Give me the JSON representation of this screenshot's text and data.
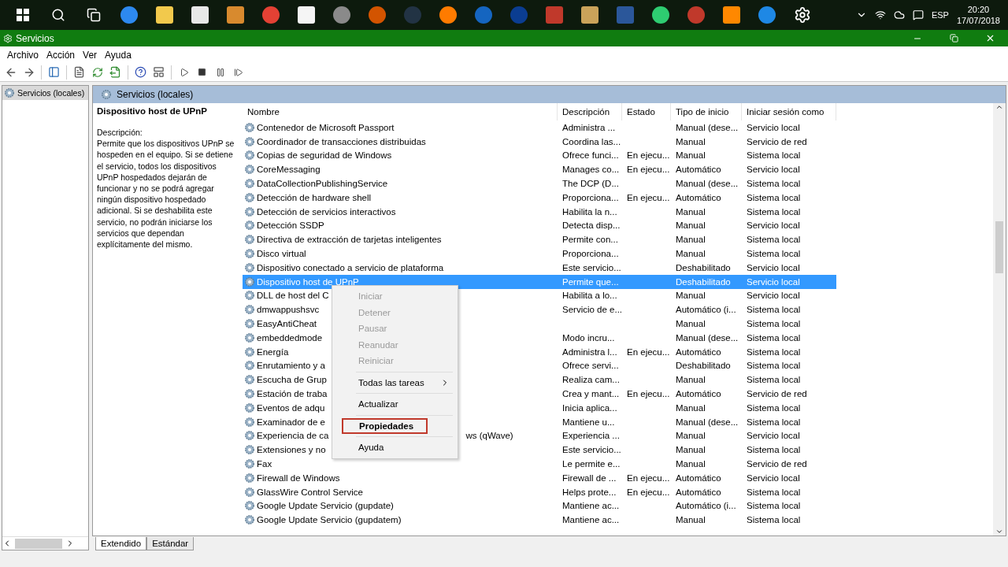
{
  "taskbar": {
    "language": "ESP",
    "time": "20:20",
    "date": "17/07/2018"
  },
  "window": {
    "title": "Servicios"
  },
  "menu": [
    "Archivo",
    "Acción",
    "Ver",
    "Ayuda"
  ],
  "tree": [
    {
      "label": "Servicios (locales)",
      "selected": true
    }
  ],
  "pane_header": "Servicios (locales)",
  "details": {
    "title": "Dispositivo host de UPnP",
    "label": "Descripción:",
    "text": "Permite que los dispositivos UPnP se hospeden en el equipo. Si se detiene el servicio, todos los dispositivos UPnP hospedados dejarán de funcionar y no se podrá agregar ningún dispositivo hospedado adicional. Si se deshabilita este servicio, no podrán iniciarse los servicios que dependan explícitamente del mismo."
  },
  "table": {
    "columns": [
      "Nombre",
      "Descripción",
      "Estado",
      "Tipo de inicio",
      "Iniciar sesión como"
    ],
    "rows": [
      {
        "name": "Contenedor de Microsoft Passport",
        "desc": "Administra ...",
        "state": "",
        "startup": "Manual (dese...",
        "logon": "Servicio local",
        "selected": false
      },
      {
        "name": "Coordinador de transacciones distribuidas",
        "desc": "Coordina las...",
        "state": "",
        "startup": "Manual",
        "logon": "Servicio de red",
        "selected": false
      },
      {
        "name": "Copias de seguridad de Windows",
        "desc": "Ofrece funci...",
        "state": "En ejecu...",
        "startup": "Manual",
        "logon": "Sistema local",
        "selected": false
      },
      {
        "name": "CoreMessaging",
        "desc": "Manages co...",
        "state": "En ejecu...",
        "startup": "Automático",
        "logon": "Servicio local",
        "selected": false
      },
      {
        "name": "DataCollectionPublishingService",
        "desc": "The DCP (D...",
        "state": "",
        "startup": "Manual (dese...",
        "logon": "Sistema local",
        "selected": false
      },
      {
        "name": "Detección de hardware shell",
        "desc": "Proporciona...",
        "state": "En ejecu...",
        "startup": "Automático",
        "logon": "Sistema local",
        "selected": false
      },
      {
        "name": "Detección de servicios interactivos",
        "desc": "Habilita la n...",
        "state": "",
        "startup": "Manual",
        "logon": "Sistema local",
        "selected": false
      },
      {
        "name": "Detección SSDP",
        "desc": "Detecta disp...",
        "state": "",
        "startup": "Manual",
        "logon": "Servicio local",
        "selected": false
      },
      {
        "name": "Directiva de extracción de tarjetas inteligentes",
        "desc": "Permite con...",
        "state": "",
        "startup": "Manual",
        "logon": "Sistema local",
        "selected": false
      },
      {
        "name": "Disco virtual",
        "desc": "Proporciona...",
        "state": "",
        "startup": "Manual",
        "logon": "Sistema local",
        "selected": false
      },
      {
        "name": "Dispositivo conectado a servicio de plataforma",
        "desc": "Este servicio...",
        "state": "",
        "startup": "Deshabilitado",
        "logon": "Servicio local",
        "selected": false
      },
      {
        "name": "Dispositivo host de UPnP",
        "desc": "Permite que...",
        "state": "",
        "startup": "Deshabilitado",
        "logon": "Servicio local",
        "selected": true
      },
      {
        "name": "DLL de host del C",
        "desc": "Habilita a lo...",
        "state": "",
        "startup": "Manual",
        "logon": "Servicio local",
        "selected": false
      },
      {
        "name": "dmwappushsvc",
        "desc": "Servicio de e...",
        "state": "",
        "startup": "Automático (i...",
        "logon": "Sistema local",
        "selected": false
      },
      {
        "name": "EasyAntiCheat",
        "desc": "",
        "state": "",
        "startup": "Manual",
        "logon": "Sistema local",
        "selected": false
      },
      {
        "name": "embeddedmode",
        "desc": "Modo incru...",
        "state": "",
        "startup": "Manual (dese...",
        "logon": "Sistema local",
        "selected": false
      },
      {
        "name": "Energía",
        "desc": "Administra l...",
        "state": "En ejecu...",
        "startup": "Automático",
        "logon": "Sistema local",
        "selected": false
      },
      {
        "name": "Enrutamiento y a",
        "desc": "Ofrece servi...",
        "state": "",
        "startup": "Deshabilitado",
        "logon": "Sistema local",
        "selected": false
      },
      {
        "name": "Escucha de Grup",
        "desc": "Realiza cam...",
        "state": "",
        "startup": "Manual",
        "logon": "Sistema local",
        "selected": false
      },
      {
        "name": "Estación de traba",
        "desc": "Crea y mant...",
        "state": "En ejecu...",
        "startup": "Automático",
        "logon": "Servicio de red",
        "selected": false
      },
      {
        "name": "Eventos de adqu",
        "desc": "Inicia aplica...",
        "state": "",
        "startup": "Manual",
        "logon": "Sistema local",
        "selected": false
      },
      {
        "name": "Examinador de e",
        "desc": "Mantiene u...",
        "state": "",
        "startup": "Manual (dese...",
        "logon": "Sistema local",
        "selected": false
      },
      {
        "name": "Experiencia de ca",
        "name_tail": "ws (qWave)",
        "desc": "Experiencia ...",
        "state": "",
        "startup": "Manual",
        "logon": "Servicio local",
        "selected": false
      },
      {
        "name": "Extensiones y no",
        "desc": "Este servicio...",
        "state": "",
        "startup": "Manual",
        "logon": "Sistema local",
        "selected": false
      },
      {
        "name": "Fax",
        "desc": "Le permite e...",
        "state": "",
        "startup": "Manual",
        "logon": "Servicio de red",
        "selected": false
      },
      {
        "name": "Firewall de Windows",
        "desc": "Firewall de ...",
        "state": "En ejecu...",
        "startup": "Automático",
        "logon": "Servicio local",
        "selected": false
      },
      {
        "name": "GlassWire Control Service",
        "desc": "Helps prote...",
        "state": "En ejecu...",
        "startup": "Automático",
        "logon": "Sistema local",
        "selected": false
      },
      {
        "name": "Google Update Servicio (gupdate)",
        "desc": "Mantiene ac...",
        "state": "",
        "startup": "Automático (i...",
        "logon": "Sistema local",
        "selected": false
      },
      {
        "name": "Google Update Servicio (gupdatem)",
        "desc": "Mantiene ac...",
        "state": "",
        "startup": "Manual",
        "logon": "Sistema local",
        "selected": false
      }
    ]
  },
  "context_menu": [
    {
      "kind": "item",
      "label": "Iniciar",
      "disabled": true
    },
    {
      "kind": "item",
      "label": "Detener",
      "disabled": true
    },
    {
      "kind": "item",
      "label": "Pausar",
      "disabled": true
    },
    {
      "kind": "item",
      "label": "Reanudar",
      "disabled": true
    },
    {
      "kind": "item",
      "label": "Reiniciar",
      "disabled": true
    },
    {
      "kind": "separator"
    },
    {
      "kind": "submenu",
      "label": "Todas las tareas",
      "disabled": false
    },
    {
      "kind": "separator"
    },
    {
      "kind": "item",
      "label": "Actualizar",
      "disabled": false
    },
    {
      "kind": "separator"
    },
    {
      "kind": "item",
      "label": "Propiedades",
      "disabled": false,
      "default": true,
      "highlighted": true
    },
    {
      "kind": "separator"
    },
    {
      "kind": "item",
      "label": "Ayuda",
      "disabled": false
    }
  ],
  "view_tabs": [
    {
      "label": "Extendido",
      "selected": true
    },
    {
      "label": "Estándar",
      "selected": false
    }
  ]
}
